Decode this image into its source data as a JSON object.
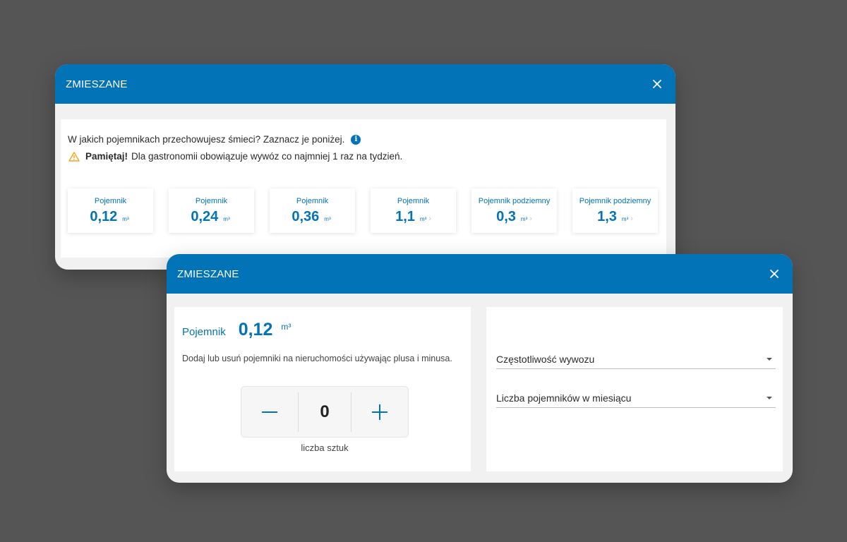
{
  "modal_back": {
    "title": "ZMIESZANE",
    "question": "W jakich pojemnikach przechowujesz śmieci? Zaznacz je poniżej.",
    "warning_bold": "Pamiętaj!",
    "warning_text": "Dla gastronomii obowiązuje wywóz co najmniej 1 raz na tydzień.",
    "tiles": [
      {
        "label": "Pojemnik",
        "value": "0,12",
        "unit": "m³",
        "chevron": ""
      },
      {
        "label": "Pojemnik",
        "value": "0,24",
        "unit": "m³",
        "chevron": ""
      },
      {
        "label": "Pojemnik",
        "value": "0,36",
        "unit": "m³",
        "chevron": ""
      },
      {
        "label": "Pojemnik",
        "value": "1,1",
        "unit": "m³",
        "chevron": "›"
      },
      {
        "label": "Pojemnik podziemny",
        "value": "0,3",
        "unit": "m³",
        "chevron": "›"
      },
      {
        "label": "Pojemnik podziemny",
        "value": "1,3",
        "unit": "m³",
        "chevron": "›"
      }
    ]
  },
  "modal_front": {
    "title": "ZMIESZANE",
    "selected_label": "Pojemnik",
    "selected_value": "0,12",
    "selected_unit": "m³",
    "help_text": "Dodaj lub usuń pojemniki na nieruchomości używając plusa i minusa.",
    "count": "0",
    "count_caption": "liczba sztuk",
    "frequency_label": "Częstotliwość wywozu",
    "monthly_count_label": "Liczba pojemników w miesiącu"
  },
  "colors": {
    "brand_blue": "#0373b8",
    "warning_orange": "#f5a623",
    "backdrop": "#555555"
  },
  "icons": {
    "close": "close-icon",
    "info": "info-icon",
    "warning": "warning-icon",
    "minus": "minus-icon",
    "plus": "plus-icon",
    "dropdown": "caret-down-icon"
  }
}
